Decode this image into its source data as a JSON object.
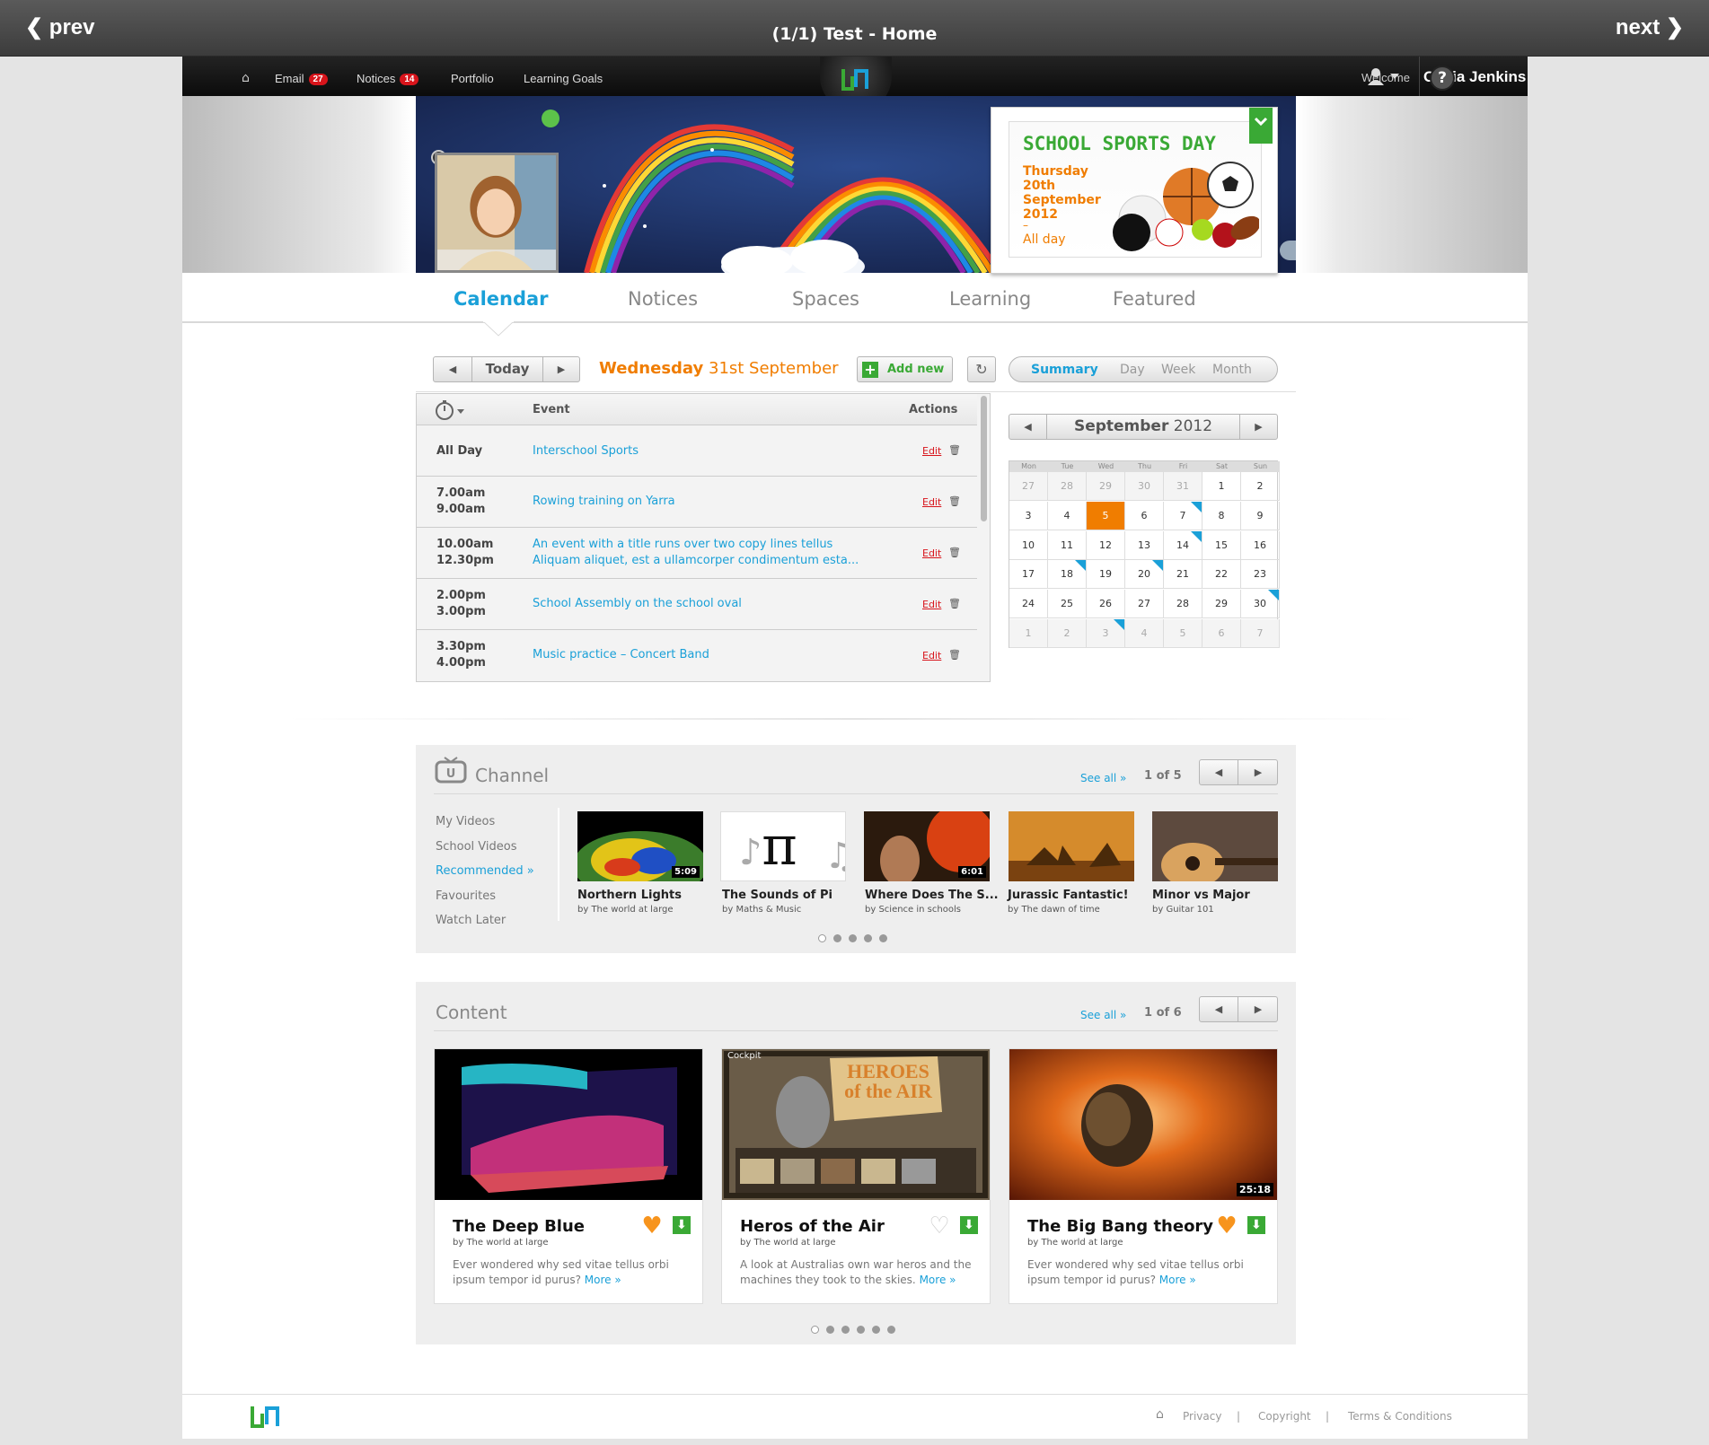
{
  "viewer": {
    "prev": "prev",
    "title": "(1/1) Test - Home",
    "next": "next"
  },
  "topnav": {
    "items": [
      {
        "label": "Email",
        "badge": "27"
      },
      {
        "label": "Notices",
        "badge": "14"
      },
      {
        "label": "Portfolio"
      },
      {
        "label": "Learning Goals"
      }
    ],
    "welcome": "Welcome",
    "user_name": "Olivia Jenkins",
    "help": "?"
  },
  "banner": {
    "event_title": "SCHOOL SPORTS DAY",
    "event_date": "Thursday 20th September 2012",
    "event_sep": "–",
    "event_time": "All day"
  },
  "tabs": [
    "Calendar",
    "Notices",
    "Spaces",
    "Learning",
    "Featured"
  ],
  "active_tab": "Calendar",
  "calendar": {
    "today_label": "Today",
    "date_day": "Wednesday",
    "date_rest": "31st September",
    "add_new": "Add new",
    "views": [
      "Summary",
      "Day",
      "Week",
      "Month"
    ],
    "active_view": "Summary",
    "table_headers": {
      "event": "Event",
      "actions": "Actions"
    },
    "events": [
      {
        "time_start": "All Day",
        "time_end": "",
        "title_line1": "Interschool Sports",
        "title_line2": "",
        "action": "Edit"
      },
      {
        "time_start": "7.00am",
        "time_end": "9.00am",
        "title_line1": "Rowing training on Yarra",
        "title_line2": "",
        "action": "Edit"
      },
      {
        "time_start": "10.00am",
        "time_end": "12.30pm",
        "title_line1": "An event with a title runs over two copy lines tellus",
        "title_line2": "Aliquam aliquet, est a ullamcorper condimentum esta...",
        "action": "Edit"
      },
      {
        "time_start": "2.00pm",
        "time_end": "3.00pm",
        "title_line1": "School Assembly on the school oval",
        "title_line2": "",
        "action": "Edit"
      },
      {
        "time_start": "3.30pm",
        "time_end": "4.00pm",
        "title_line1": "Music practice – Concert Band",
        "title_line2": "",
        "action": "Edit"
      }
    ],
    "mini": {
      "month": "September",
      "year": "2012",
      "weekdays": [
        "Mon",
        "Tue",
        "Wed",
        "Thu",
        "Fri",
        "Sat",
        "Sun"
      ],
      "weeks": [
        [
          "27",
          "28",
          "29",
          "30",
          "31",
          "1",
          "2"
        ],
        [
          "3",
          "4",
          "5",
          "6",
          "7",
          "8",
          "9"
        ],
        [
          "10",
          "11",
          "12",
          "13",
          "14",
          "15",
          "16"
        ],
        [
          "17",
          "18",
          "19",
          "20",
          "21",
          "22",
          "23"
        ],
        [
          "24",
          "25",
          "26",
          "27",
          "28",
          "29",
          "30"
        ],
        [
          "1",
          "2",
          "3",
          "4",
          "5",
          "6",
          "7"
        ]
      ],
      "selected": "5",
      "highlight_color": "#f07d00",
      "event_marker_color": "#1aa0d8"
    }
  },
  "channel": {
    "title": "Channel",
    "see_all": "See all »",
    "pager": "1 of 5",
    "sidebar": [
      "My Videos",
      "School Videos",
      "Recommended »",
      "Favourites",
      "Watch Later"
    ],
    "active_sidebar": "Recommended »",
    "videos": [
      {
        "title": "Northern Lights",
        "by": "by The world at large",
        "duration": "5:09"
      },
      {
        "title": "The Sounds of Pi",
        "by": "by Maths & Music",
        "duration": ""
      },
      {
        "title": "Where Does The S...",
        "by": "by Science in schools",
        "duration": "6:01"
      },
      {
        "title": "Jurassic Fantastic!",
        "by": "by The dawn of time",
        "duration": ""
      },
      {
        "title": "Minor vs Major",
        "by": "by Guitar 101",
        "duration": ""
      }
    ],
    "page_count": 5,
    "current_page": 1
  },
  "content": {
    "title": "Content",
    "see_all": "See all »",
    "pager": "1 of 6",
    "items": [
      {
        "title": "The Deep Blue",
        "by": "by The world at large",
        "desc": "Ever wondered why sed vitae tellus orbi ipsum  tempor id purus?",
        "more": "More »",
        "favourite": true,
        "duration": ""
      },
      {
        "title": "Heros of the Air",
        "by": "by The world at large",
        "desc": "A look at Australias own war heros and the machines they took to the skies.",
        "more": "More »",
        "favourite": false,
        "duration": "",
        "image_text_1": "HEROES of the AIR",
        "image_text_2": "Cockpit"
      },
      {
        "title": "The Big Bang theory",
        "by": "by The world at large",
        "desc": "Ever wondered why sed vitae tellus orbi ipsum  tempor id purus?",
        "more": "More »",
        "favourite": true,
        "duration": "25:18"
      }
    ],
    "page_count": 6,
    "current_page": 1
  },
  "footer": {
    "links": [
      "Privacy",
      "Copyright",
      "Terms & Conditions"
    ]
  },
  "colors": {
    "accent_blue": "#1aa0d8",
    "accent_orange": "#f07d00",
    "accent_green": "#3aa935",
    "badge_red": "#d8141b"
  }
}
